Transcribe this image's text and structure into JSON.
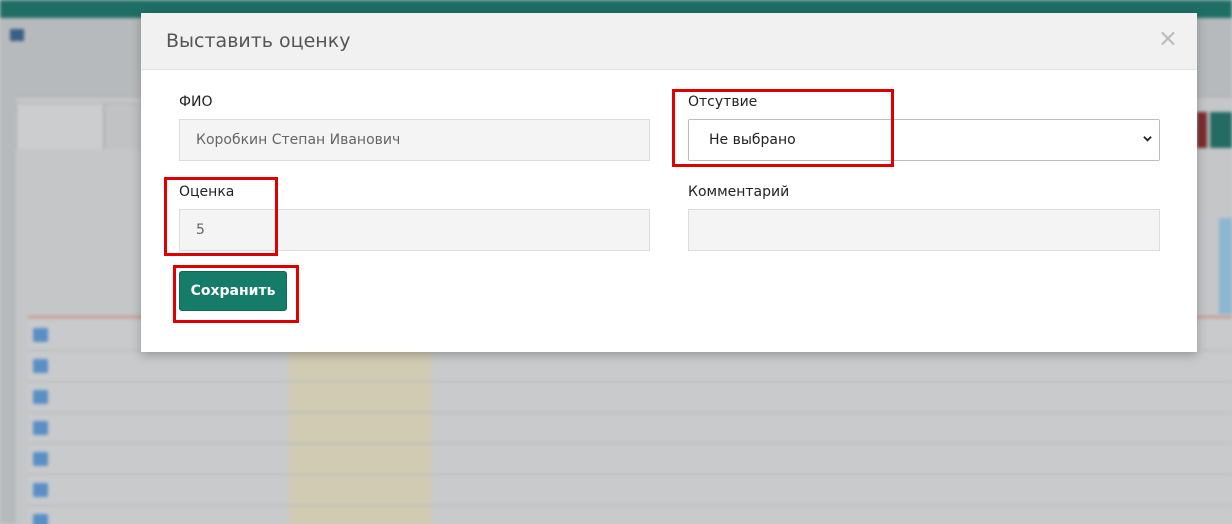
{
  "modal": {
    "title": "Выставить оценку",
    "fields": {
      "fio_label": "ФИО",
      "fio_value": "Коробкин Степан Иванович",
      "absence_label": "Отсутвие",
      "absence_value": "Не выбрано",
      "grade_label": "Оценка",
      "grade_value": "5",
      "comment_label": "Комментарий",
      "comment_value": ""
    },
    "save_label": "Сохранить"
  },
  "colors": {
    "primary_button": "#147c69",
    "highlight": "#e00000"
  }
}
